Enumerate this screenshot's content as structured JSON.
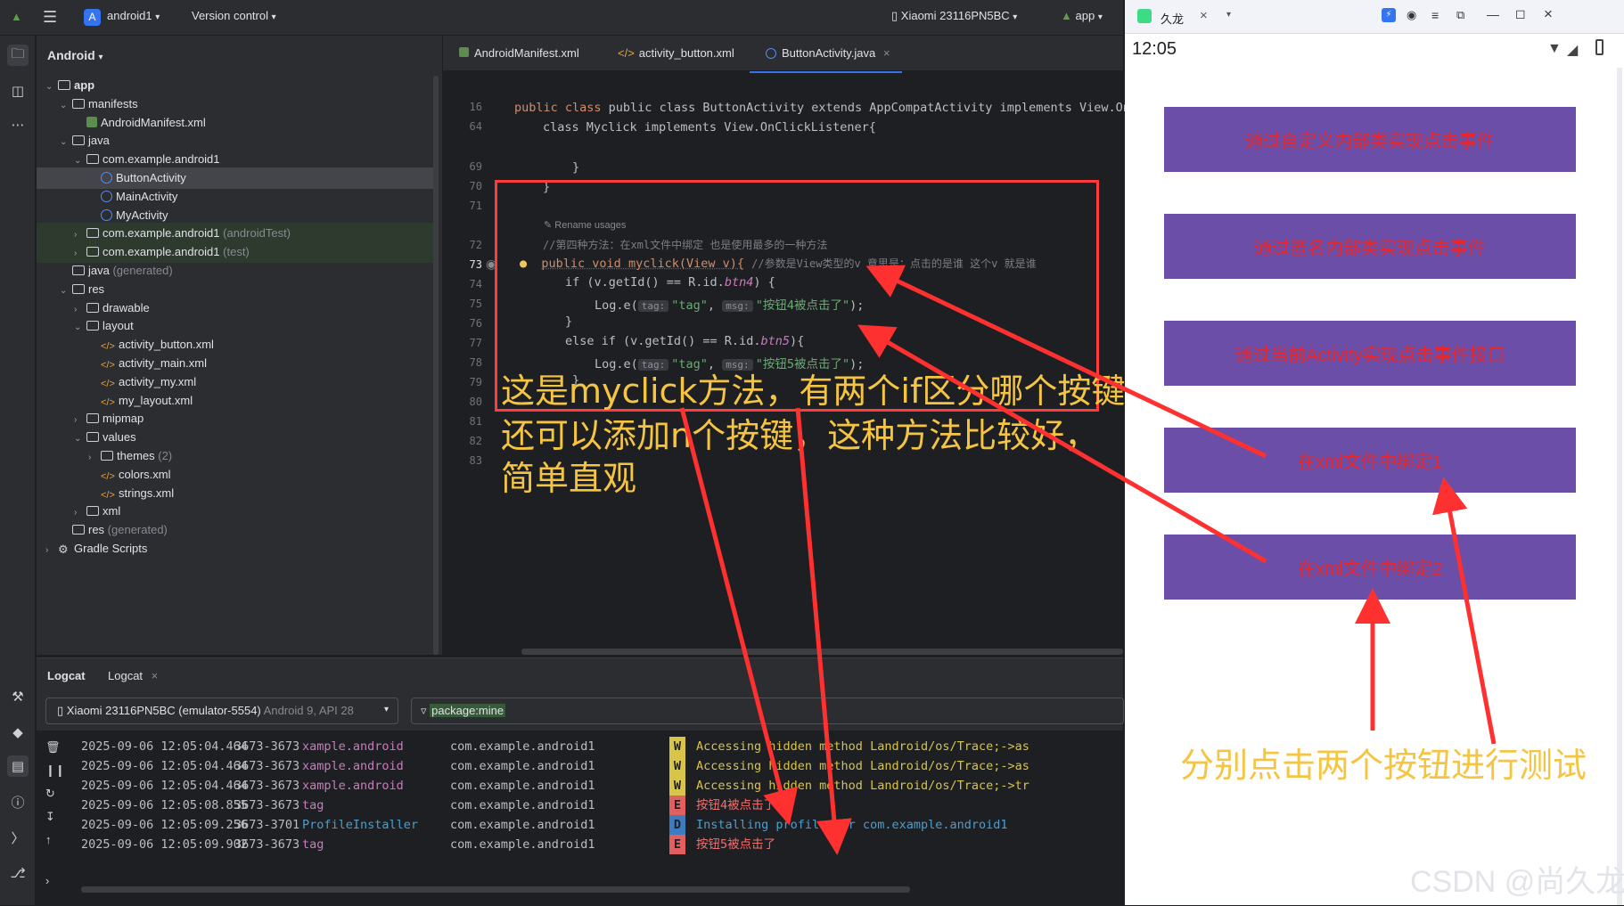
{
  "titlebar": {
    "project_badge": "A",
    "project": "android1",
    "vcs": "Version control",
    "device": "Xiaomi 23116PN5BC",
    "run_config": "app"
  },
  "project_panel": {
    "title": "Android",
    "tree": [
      {
        "label": "app",
        "type": "folder",
        "depth": 0,
        "bold": true,
        "tw": "v"
      },
      {
        "label": "manifests",
        "type": "folder",
        "depth": 1,
        "tw": "v"
      },
      {
        "label": "AndroidManifest.xml",
        "type": "manifest",
        "depth": 2,
        "tw": ""
      },
      {
        "label": "java",
        "type": "folder",
        "depth": 1,
        "tw": "v"
      },
      {
        "label": "com.example.android1",
        "type": "folder",
        "depth": 2,
        "tw": "v"
      },
      {
        "label": "ButtonActivity",
        "type": "class",
        "depth": 3,
        "tw": "",
        "selected": true
      },
      {
        "label": "MainActivity",
        "type": "class",
        "depth": 3,
        "tw": ""
      },
      {
        "label": "MyActivity",
        "type": "class",
        "depth": 3,
        "tw": ""
      },
      {
        "label": "com.example.android1",
        "suffix": "(androidTest)",
        "type": "folder",
        "depth": 2,
        "tw": ">",
        "test": true
      },
      {
        "label": "com.example.android1",
        "suffix": "(test)",
        "type": "folder",
        "depth": 2,
        "tw": ">",
        "test": true
      },
      {
        "label": "java",
        "suffix": "(generated)",
        "type": "folder",
        "depth": 1,
        "tw": ""
      },
      {
        "label": "res",
        "type": "folder",
        "depth": 1,
        "tw": "v"
      },
      {
        "label": "drawable",
        "type": "folder",
        "depth": 2,
        "tw": ">"
      },
      {
        "label": "layout",
        "type": "folder",
        "depth": 2,
        "tw": "v"
      },
      {
        "label": "activity_button.xml",
        "type": "xml",
        "depth": 3,
        "tw": ""
      },
      {
        "label": "activity_main.xml",
        "type": "xml",
        "depth": 3,
        "tw": ""
      },
      {
        "label": "activity_my.xml",
        "type": "xml",
        "depth": 3,
        "tw": ""
      },
      {
        "label": "my_layout.xml",
        "type": "xml",
        "depth": 3,
        "tw": ""
      },
      {
        "label": "mipmap",
        "type": "folder",
        "depth": 2,
        "tw": ">"
      },
      {
        "label": "values",
        "type": "folder",
        "depth": 2,
        "tw": "v"
      },
      {
        "label": "themes",
        "suffix": "(2)",
        "type": "folder",
        "depth": 3,
        "tw": ">"
      },
      {
        "label": "colors.xml",
        "type": "xml",
        "depth": 3,
        "tw": ""
      },
      {
        "label": "strings.xml",
        "type": "xml",
        "depth": 3,
        "tw": ""
      },
      {
        "label": "xml",
        "type": "folder",
        "depth": 2,
        "tw": ">"
      },
      {
        "label": "res",
        "suffix": "(generated)",
        "type": "folder",
        "depth": 1,
        "tw": ""
      },
      {
        "label": "Gradle Scripts",
        "type": "gradle",
        "depth": 0,
        "tw": ">"
      }
    ]
  },
  "editor": {
    "tabs": [
      "AndroidManifest.xml",
      "activity_button.xml",
      "ButtonActivity.java"
    ],
    "active_tab": "ButtonActivity.java",
    "line_numbers": [
      "16",
      "64",
      "69",
      "70",
      "71",
      "72",
      "73",
      "74",
      "75",
      "76",
      "77",
      "78",
      "79",
      "80",
      "81",
      "82",
      "83"
    ],
    "line_16": "public class ButtonActivity extends AppCompatActivity implements View.OnClickListener",
    "line_64": "class Myclick implements View.OnClickListener{",
    "line_69": "}",
    "line_70": "}",
    "rename_hint": "Rename usages",
    "comment_72": "//第四种方法：在xml文件中绑定      也是使用最多的一种方法",
    "line_73_code": "public void myclick(View v){",
    "line_73_comment": "//参数是View类型的v   意思是：点击的是谁  这个v 就是谁",
    "line_74_a": "if (v.getId() == R.id.",
    "line_74_id": "btn4",
    "line_74_b": ") {",
    "line_75_call": "Log.e(",
    "line_75_tag_hint": "tag:",
    "line_75_tag": "\"tag\"",
    "line_75_msg_hint": "msg:",
    "line_75_msg": "\"按钮4被点击了\"",
    "line_75_end": ");",
    "line_76": "}",
    "line_77_a": "else if (v.getId() == R.id.",
    "line_77_id": "btn5",
    "line_77_b": "){",
    "line_78_msg": "\"按钮5被点击了\"",
    "line_79": "}",
    "annotation_lines": [
      "这是myclick方法，有两个if区分哪个按键",
      "还可以添加n个按键，这种方法比较好，",
      "简单直观"
    ]
  },
  "logcat": {
    "tabs": [
      "Logcat",
      "Logcat"
    ],
    "device": "Xiaomi 23116PN5BC (emulator-5554)",
    "device_suffix": "Android 9, API 28",
    "filter": "package:mine",
    "rows": [
      {
        "time": "2025-09-06 12:05:04.464",
        "pid": "3673-3673",
        "tag": "xample.android",
        "pkg": "com.example.android1",
        "level": "W",
        "msg": "Accessing hidden method Landroid/os/Trace;->as"
      },
      {
        "time": "2025-09-06 12:05:04.464",
        "pid": "3673-3673",
        "tag": "xample.android",
        "pkg": "com.example.android1",
        "level": "W",
        "msg": "Accessing hidden method Landroid/os/Trace;->as"
      },
      {
        "time": "2025-09-06 12:05:04.464",
        "pid": "3673-3673",
        "tag": "xample.android",
        "pkg": "com.example.android1",
        "level": "W",
        "msg": "Accessing hidden method Landroid/os/Trace;->tr"
      },
      {
        "time": "2025-09-06 12:05:08.855",
        "pid": "3673-3673",
        "tag": "tag",
        "pkg": "com.example.android1",
        "level": "E",
        "msg": "按钮4被点击了"
      },
      {
        "time": "2025-09-06 12:05:09.256",
        "pid": "3673-3701",
        "tag": "ProfileInstaller",
        "pkg": "com.example.android1",
        "level": "D",
        "msg": "Installing profile for com.example.android1"
      },
      {
        "time": "2025-09-06 12:05:09.902",
        "pid": "3673-3673",
        "tag": "tag",
        "pkg": "com.example.android1",
        "level": "E",
        "msg": "按钮5被点击了"
      }
    ]
  },
  "phone": {
    "window_title": "久龙",
    "clock": "12:05",
    "buttons": [
      "通过自定义内部类实现点击事件",
      "通过匿名内部类实现点击事件",
      "通过当前Activity实现点击事件接口",
      "在xml文件中绑定1",
      "在xml文件中绑定2"
    ],
    "annotation": "分别点击两个按钮进行测试"
  },
  "watermark": "CSDN @尚久龙",
  "colors": {
    "ide_bg": "#1e1f22",
    "panel_bg": "#2b2d30",
    "accent": "#3574f0",
    "phone_button": "#6a4ea8",
    "phone_button_text": "#e8262a",
    "annotation": "#f5c542",
    "arrow_red": "#ff3030"
  }
}
